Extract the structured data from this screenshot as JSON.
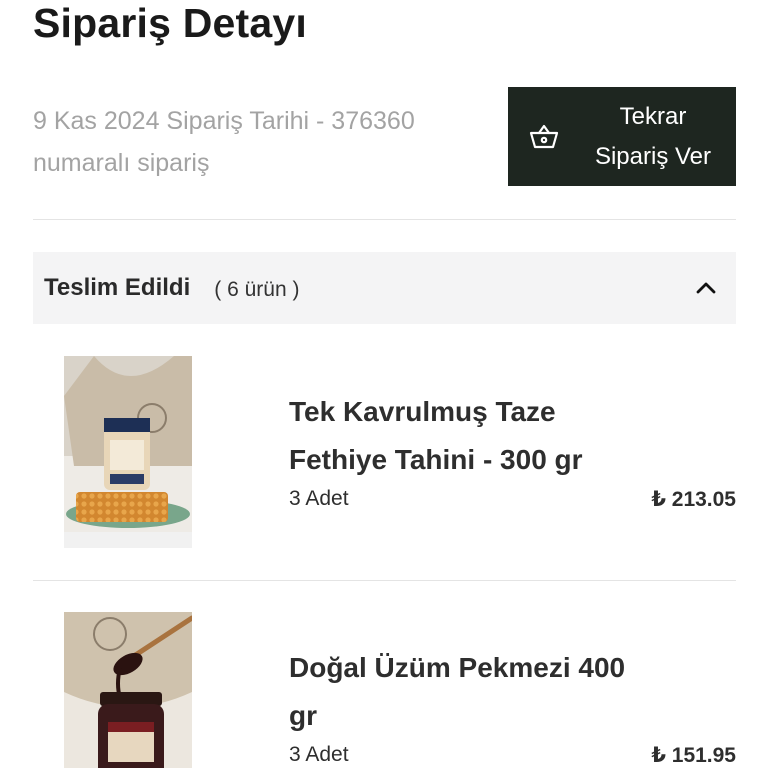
{
  "header": {
    "title": "Sipariş Detayı"
  },
  "order": {
    "meta_line1": "9 Kas 2024 Sipariş Tarihi - 376360",
    "meta_line2": "numaralı sipariş",
    "reorder_line1": "Tekrar",
    "reorder_line2": "Sipariş Ver",
    "reorder_icon": "basket-icon"
  },
  "shipment": {
    "status": "Teslim Edildi",
    "count": "( 6 ürün )",
    "toggle_icon": "chevron-up-icon"
  },
  "products": [
    {
      "name": "Tek Kavrulmuş Taze Fethiye Tahini - 300 gr",
      "quantity": "3 Adet",
      "price": "₺ 213.05"
    },
    {
      "name": "Doğal Üzüm Pekmezi 400 gr",
      "quantity": "3 Adet",
      "price": "₺ 151.95"
    }
  ],
  "colors": {
    "button_bg": "#1e2620",
    "status_bg": "#f4f4f5",
    "muted_text": "#a3a3a3"
  }
}
